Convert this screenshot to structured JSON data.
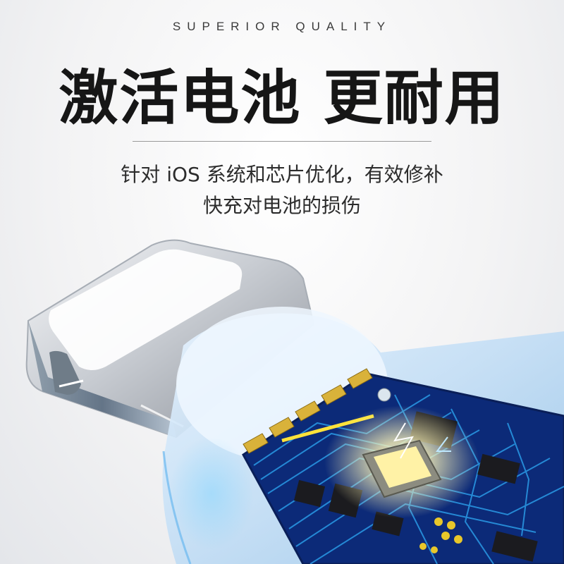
{
  "tagline": "SUPERIOR QUALITY",
  "headline": "激活电池 更耐用",
  "description": {
    "line1": "针对 iOS 系统和芯片优化，有效修补",
    "line2": "快充对电池的损伤"
  },
  "colors": {
    "circuit_board": "#0c2a78",
    "trace": "#1f8fe0",
    "chip_glow": "#fff0a0",
    "gold_contact": "#d9b23a",
    "connector_metal": "#cfd3d8"
  }
}
